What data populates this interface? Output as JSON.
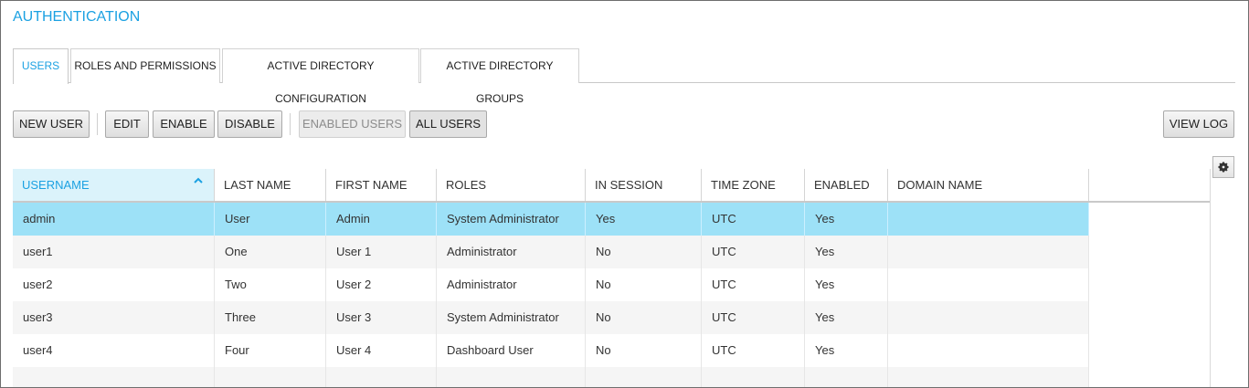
{
  "page": {
    "title": "AUTHENTICATION"
  },
  "tabs": [
    {
      "label": "USERS",
      "active": true
    },
    {
      "label": "ROLES AND PERMISSIONS",
      "active": false
    },
    {
      "label": "ACTIVE DIRECTORY CONFIGURATION",
      "active": false
    },
    {
      "label": "ACTIVE DIRECTORY GROUPS",
      "active": false
    }
  ],
  "toolbar": {
    "new_user": "NEW USER",
    "edit": "EDIT",
    "enable": "ENABLE",
    "disable": "DISABLE",
    "enabled_users": "ENABLED USERS",
    "all_users": "ALL USERS",
    "view_log": "VIEW LOG"
  },
  "table": {
    "columns": [
      "USERNAME",
      "LAST NAME",
      "FIRST NAME",
      "ROLES",
      "IN SESSION",
      "TIME ZONE",
      "ENABLED",
      "DOMAIN NAME"
    ],
    "sorted_column": "USERNAME",
    "sort_direction": "ascending",
    "selected_row": 0,
    "rows": [
      [
        "admin",
        "User",
        "Admin",
        "System Administrator",
        "Yes",
        "UTC",
        "Yes",
        ""
      ],
      [
        "user1",
        "One",
        "User 1",
        "Administrator",
        "No",
        "UTC",
        "Yes",
        ""
      ],
      [
        "user2",
        "Two",
        "User 2",
        "Administrator",
        "No",
        "UTC",
        "Yes",
        ""
      ],
      [
        "user3",
        "Three",
        "User 3",
        "System Administrator",
        "No",
        "UTC",
        "Yes",
        ""
      ],
      [
        "user4",
        "Four",
        "User 4",
        "Dashboard User",
        "No",
        "UTC",
        "Yes",
        ""
      ],
      [
        "",
        "",
        "",
        "",
        "",
        "",
        "",
        ""
      ]
    ]
  },
  "colors": {
    "accent": "#1ba1e2",
    "selected_row": "#9de1f7",
    "sorted_header": "#dbf3fb"
  },
  "icons": {
    "settings": "gear-icon",
    "sort": "sort-ascending-icon"
  }
}
